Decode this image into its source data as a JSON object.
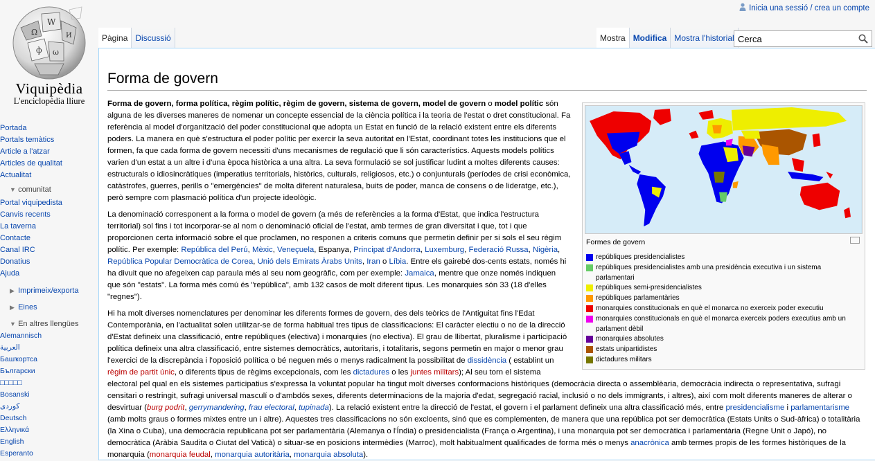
{
  "personal": {
    "link": "Inicia una sessió / crea un compte"
  },
  "logo": {
    "wordmark": "Viquipèdia",
    "tagline": "L'enciclopèdia lliure"
  },
  "nav": {
    "main": [
      "Portada",
      "Portals temàtics",
      "Article a l'atzar",
      "Articles de qualitat",
      "Actualitat"
    ],
    "community": {
      "heading": "comunitat",
      "items": [
        "Portal viquipedista",
        "Canvis recents",
        "La taverna",
        "Contacte",
        "Canal IRC",
        "Donatius",
        "Ajuda"
      ]
    },
    "print": {
      "heading": "Imprimeix/exporta"
    },
    "tools": {
      "heading": "Eines"
    },
    "languages": {
      "heading": "En altres llengües",
      "items": [
        "Alemannisch",
        "العربية",
        "Башҡортса",
        "Български",
        "□□□□□",
        "Bosanski",
        "کوردی",
        "Deutsch",
        "Ελληνικά",
        "English",
        "Esperanto"
      ]
    }
  },
  "tabs": {
    "left": [
      "Pàgina",
      "Discussió"
    ],
    "right": [
      "Mostra",
      "Modifica",
      "Mostra l'historial"
    ]
  },
  "search": {
    "value": "Cerca"
  },
  "article": {
    "title": "Forma de govern",
    "p1": {
      "b1": "Forma de govern, forma política, règim polític, règim de govern, sistema de govern, model de govern",
      "t1": " o ",
      "b2": "model polític",
      "t2": " són alguna de les diverses maneres de nomenar un concepte essencial de la ciència política i la teoria de l'estat o dret constitucional. Fa referència al model d'organització del poder constitucional que adopta un Estat en funció de la relació existent entre els diferents poders. La manera en què s'estructura el poder polític per exercir la seva autoritat en l'Estat, coordinant totes les institucions que el formen, fa que cada forma de govern necessiti d'uns mecanismes de regulació que li són característics. Aquests models polítics varien d'un estat a un altre i d'una època històrica a una altra. La seva formulació se sol justificar ludint a moltes diferents causes: estructurals o idiosincràtiques (imperatius territorials, històrics, culturals, religiosos, etc.) o conjunturals (períodes de crisi econòmica, catàstrofes, guerres, perills o \"emergències\" de molta diferent naturalesa, buits de poder, manca de consens o de lideratge, etc.), però sempre com plasmació política d'un projecte ideològic."
    },
    "p2": {
      "t1": "La denominació corresponent a la forma o model de govern (a més de referències a la forma d'Estat, que indica l'estructura territorial) sol fins i tot incorporar-se al nom o denominació oficial de l'estat, amb termes de gran diversitat i que, tot i que proporcionen certa informació sobre el que proclamen, no responen a criteris comuns que permetin definir per si sols el seu règim polític. Per exemple: ",
      "links": [
        "República del Perú",
        "Mèxic",
        "Veneçuela",
        "Espanya",
        "Principat d'Andorra",
        "Luxemburg",
        "Federació Russa",
        "Nigèria",
        "República Popular Democràtica de Corea",
        "Unió dels Emirats Àrabs Units",
        "Iran",
        "Líbia"
      ],
      "t2": ". Entre els gairebé dos-cents estats, només hi ha divuit que no afegeixen cap paraula més al seu nom geogràfic, com per exemple: ",
      "link_jamaica": "Jamaica",
      "t3": ", mentre que onze només indiquen que són \"estats\". La forma més comú és \"república\", amb 132 casos de molt diferent tipus. Les monarquies són 33 (18 d'elles \"regnes\")."
    },
    "p3": {
      "t1": "Hi ha molt diverses nomenclatures per denominar les diferents formes de govern, des dels teòrics de l'Antiguitat fins l'Edat Contemporània, en l'actualitat solen utilitzar-se de forma habitual tres tipus de classificacions: El caràcter electiu o no de la direcció d'Estat defineix una classificació, entre repúbliques (electiva) i monarquies (no electiva). El grau de llibertat, pluralisme i participació política defineix una altra classificació, entre sistemes democràtics, autoritaris, i totalitaris, segons permetin en major o menor grau l'exercici de la discrepància i l'oposició política o bé neguen més o menys radicalment la possibilitat de ",
      "l_dissidencia": "dissidència",
      "t2": " ( establint un ",
      "l_regim": "règim de partit únic",
      "t3": ", o diferents tipus de règims excepcionals, com les ",
      "l_dictadures": "dictadures",
      "t4": " o les ",
      "l_juntes": "juntes militars",
      "t5": "); Al seu torn el sistema electoral pel qual en els sistemes participatius s'expressa la voluntat popular ha tingut molt diverses conformacions històriques (democràcia directa o assemblèaria, democràcia indirecta o representativa, sufragi censitari o restringit, sufragi universal masculí o d'ambdós sexes, diferents determinacions de la majoria d'edat, segregació racial, inclusió o no dels immigrants, i altres), així com molt diferents maneres de alterar o desvirtuar (",
      "i_burg": "burg podrit",
      "c1": ", ",
      "i_gerry": "gerrymandering",
      "c2": ", ",
      "i_frau": "frau electoral",
      "c3": ", ",
      "i_tupinada": "tupinada",
      "t6": "). La relació existent entre la direcció de l'estat, el govern i el parlament defineix una altra classificació més, entre ",
      "l_presid": "presidencialisme",
      "t7": " i ",
      "l_parl": "parlamentarisme",
      "t8": " (amb molts graus o formes mixtes entre un i altre). Aquestes tres classificacions no són excloents, sinó que es complementen, de manera que una república pot ser democràtica (Estats Units o Sud-àfrica) o totalitària (la Xina o Cuba), una democràcia republicana pot ser parlamentària (Alemanya o l'Índia) o presidencialista (França o Argentina), i una monarquia pot ser democràtica i parlamentària (Regne Unit o Japó), no democràtica (Aràbia Saudita o Ciutat del Vaticà) o situar-se en posicions intermèdies (Marroc), molt habitualment qualificades de forma més o menys ",
      "l_anacr": "anacrònica",
      "t9": " amb termes propis de les formes històriques de la monarquia (",
      "l_feudal": "monarquia feudal",
      "c4": ", ",
      "l_autor": "monarquia autoritària",
      "c5": ", ",
      "l_absol": "monarquia absoluta",
      "t10": ")."
    }
  },
  "infobox": {
    "caption": "Formes de govern",
    "legend": [
      {
        "color": "#0000ee",
        "label": "repúbliques presidencialistes"
      },
      {
        "color": "#66cc66",
        "label": "repúbliques presidencialistes amb una presidència executiva i un sistema parlamentari"
      },
      {
        "color": "#eeee00",
        "label": "repúbliques semi-presidencialistes"
      },
      {
        "color": "#ff9900",
        "label": "repúbliques parlamentàries"
      },
      {
        "color": "#ee0000",
        "label": "monarquies constitucionals en què el monarca no exerceix poder executiu"
      },
      {
        "color": "#ee00ee",
        "label": "monarquies constitucionals en què el monarca exerceix poders executius amb un parlament dèbil"
      },
      {
        "color": "#660099",
        "label": "monarquies absolutes"
      },
      {
        "color": "#aa5500",
        "label": "estats unipartidistes"
      },
      {
        "color": "#777700",
        "label": "dictadures militars"
      }
    ]
  }
}
